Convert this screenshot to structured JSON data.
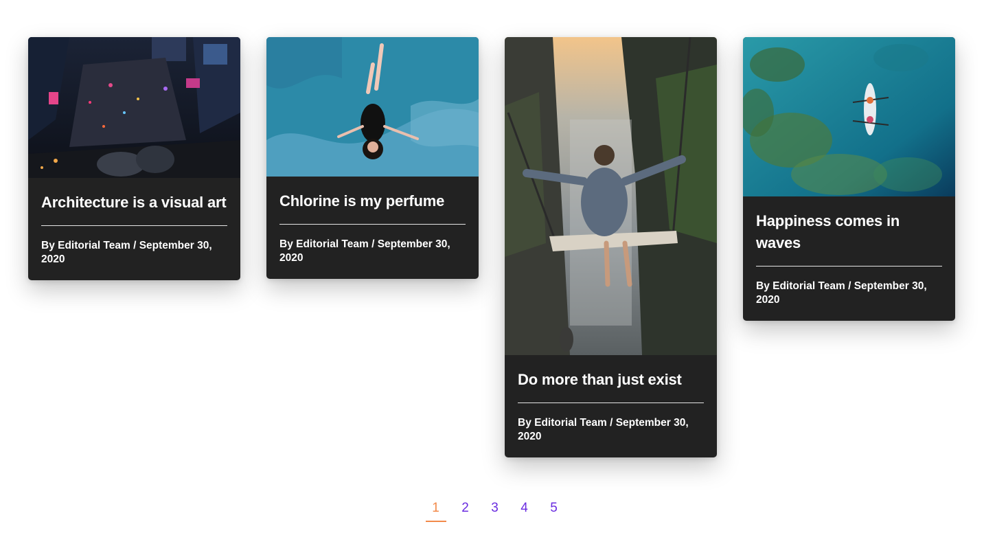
{
  "posts": [
    {
      "title": "Architecture is a visual art",
      "meta": "By Editorial Team / September 30, 2020"
    },
    {
      "title": "Chlorine is my perfume",
      "meta": "By Editorial Team / September 30, 2020"
    },
    {
      "title": "Do more than just exist",
      "meta": "By Editorial Team / September 30, 2020"
    },
    {
      "title": "Happiness comes in waves",
      "meta": "By Editorial Team / September 30, 2020"
    }
  ],
  "pagination": {
    "pages": [
      "1",
      "2",
      "3",
      "4",
      "5"
    ],
    "current": "1"
  },
  "colors": {
    "card_background": "#222222",
    "pagination_link": "#6a2ce0",
    "pagination_active": "#f28a4a"
  }
}
